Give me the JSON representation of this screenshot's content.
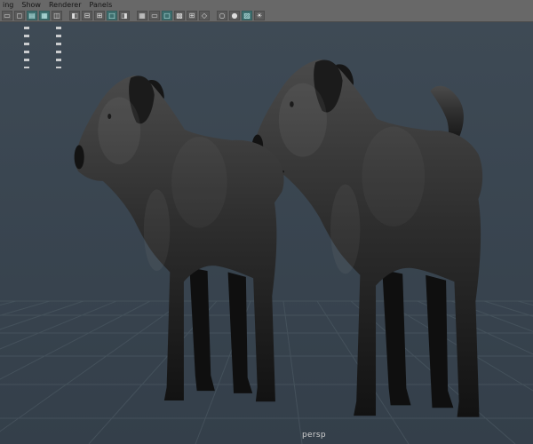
{
  "menu_bar": {
    "items": [
      "ing",
      "Show",
      "Renderer",
      "Panels"
    ]
  },
  "toolbar": {
    "icons": [
      {
        "name": "select-camera-icon",
        "glyph": "▭",
        "teal": false,
        "gap": false
      },
      {
        "name": "camera-lock-icon",
        "glyph": "◻",
        "teal": false,
        "gap": false
      },
      {
        "name": "camera-attributes-icon",
        "glyph": "▤",
        "teal": true,
        "gap": false
      },
      {
        "name": "bookmarks-icon",
        "glyph": "▦",
        "teal": true,
        "gap": false
      },
      {
        "name": "image-plane-icon",
        "glyph": "◫",
        "teal": false,
        "gap": false
      },
      {
        "name": "two-pane-layout-icon",
        "glyph": "◧",
        "teal": false,
        "gap": true
      },
      {
        "name": "stacked-pane-layout-icon",
        "glyph": "⊟",
        "teal": false,
        "gap": false
      },
      {
        "name": "four-pane-layout-icon",
        "glyph": "⊞",
        "teal": false,
        "gap": false
      },
      {
        "name": "single-pane-layout-icon",
        "glyph": "□",
        "teal": true,
        "gap": false
      },
      {
        "name": "outliner-layout-icon",
        "glyph": "◨",
        "teal": false,
        "gap": false
      },
      {
        "name": "grid-toggle-icon",
        "glyph": "▦",
        "teal": false,
        "gap": true
      },
      {
        "name": "film-gate-icon",
        "glyph": "▭",
        "teal": false,
        "gap": false
      },
      {
        "name": "resolution-gate-icon",
        "glyph": "▢",
        "teal": true,
        "gap": false
      },
      {
        "name": "gate-mask-icon",
        "glyph": "▩",
        "teal": false,
        "gap": false
      },
      {
        "name": "field-chart-icon",
        "glyph": "⊞",
        "teal": false,
        "gap": false
      },
      {
        "name": "safe-action-icon",
        "glyph": "◇",
        "teal": false,
        "gap": false
      },
      {
        "name": "wireframe-icon",
        "glyph": "○",
        "teal": false,
        "gap": true
      },
      {
        "name": "shaded-mode-icon",
        "glyph": "●",
        "teal": false,
        "gap": false
      },
      {
        "name": "textured-mode-icon",
        "glyph": "▨",
        "teal": true,
        "gap": false
      },
      {
        "name": "lighting-icon",
        "glyph": "☀",
        "teal": false,
        "gap": false
      }
    ]
  },
  "viewport": {
    "camera_label": "persp",
    "grid_visible": true,
    "models": [
      {
        "name": "dog-model-left",
        "description": "gray shaded standing dog model, tail down"
      },
      {
        "name": "dog-model-right",
        "description": "gray shaded standing dog model, mouth open, tail raised"
      }
    ]
  },
  "colors": {
    "header_bg": "#686868",
    "menu_text": "#151515",
    "viewport_bg_top": "#3e4a55",
    "viewport_bg_bottom": "#343f4a",
    "grid_line": "#48555f",
    "model_shade_light": "#4a4a4a",
    "model_shade_dark": "#121212",
    "icon_teal": "#3e6f6f",
    "camera_label_color": "#d2d2d2"
  }
}
